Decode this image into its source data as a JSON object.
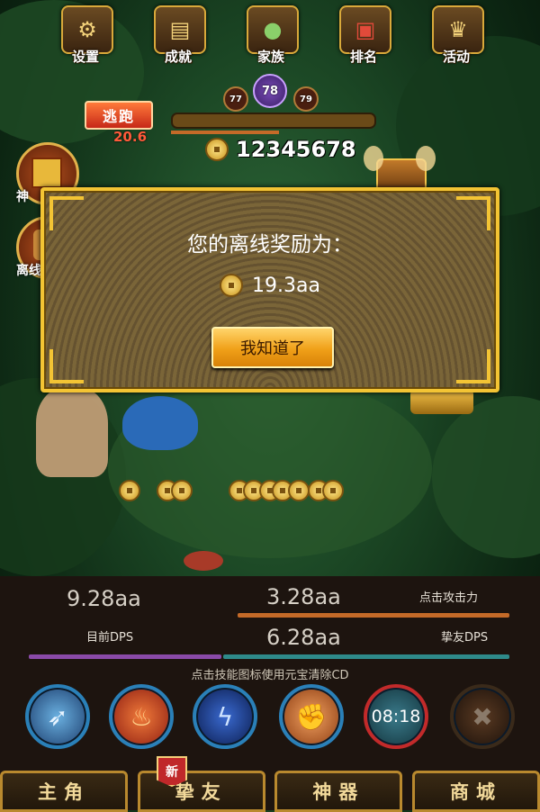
{
  "top_menu": [
    {
      "label": "设置",
      "icon": "gear-icon"
    },
    {
      "label": "成就",
      "icon": "scroll-icon"
    },
    {
      "label": "家族",
      "icon": "frog-icon"
    },
    {
      "label": "排名",
      "icon": "book-icon"
    },
    {
      "label": "活动",
      "icon": "pot-icon"
    }
  ],
  "level": {
    "prev": "77",
    "current": "78",
    "next": "79"
  },
  "flee": {
    "label": "逃跑",
    "timer": "20.6"
  },
  "gold_total": "12345678",
  "side_labels": {
    "gift": "神",
    "offline": "离线"
  },
  "dialog": {
    "title": "您的离线奖励为：",
    "reward": "19.3aa",
    "button": "我知道了"
  },
  "stats": {
    "dps_value": "9.28aa",
    "dps_label": "目前DPS",
    "tap_value": "3.28aa",
    "tap_label": "点击攻击力",
    "friend_value": "6.28aa",
    "friend_label": "挚友DPS"
  },
  "hint": "点击技能图标使用元宝清除CD",
  "skills": [
    {
      "icon": "blade-skill-icon"
    },
    {
      "icon": "fire-warrior-skill-icon"
    },
    {
      "icon": "lightning-warrior-skill-icon"
    },
    {
      "icon": "fist-skill-icon"
    },
    {
      "icon": "cooldown-skill-icon",
      "timer": "08:18"
    },
    {
      "icon": "locked-skill-icon"
    }
  ],
  "tabs": [
    "主角",
    "挚友",
    "神器",
    "商城"
  ],
  "new_badge": "新",
  "colors": {
    "dialog_border": "#f3c434",
    "button": "#f0a018",
    "dps_bar": "#8a4aa8",
    "friend_bar": "#2e8a8a",
    "tap_bar": "#c46a28"
  }
}
